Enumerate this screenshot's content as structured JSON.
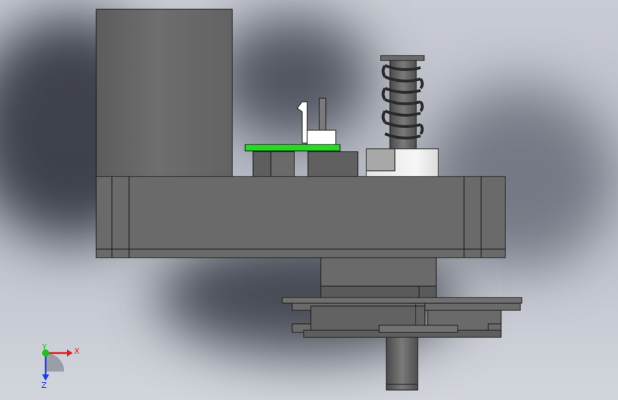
{
  "viewport": {
    "background_top": "#c9ccd4",
    "background_bottom": "#d2d5dc",
    "model_color": "#707070",
    "edge_color": "#1a1a1a",
    "highlight_color": "#22dd22"
  },
  "triad": {
    "x_label": "X",
    "y_label": "Y",
    "z_label": "Z",
    "x_color": "#e02020",
    "y_color": "#20c020",
    "z_color": "#2040e0"
  }
}
